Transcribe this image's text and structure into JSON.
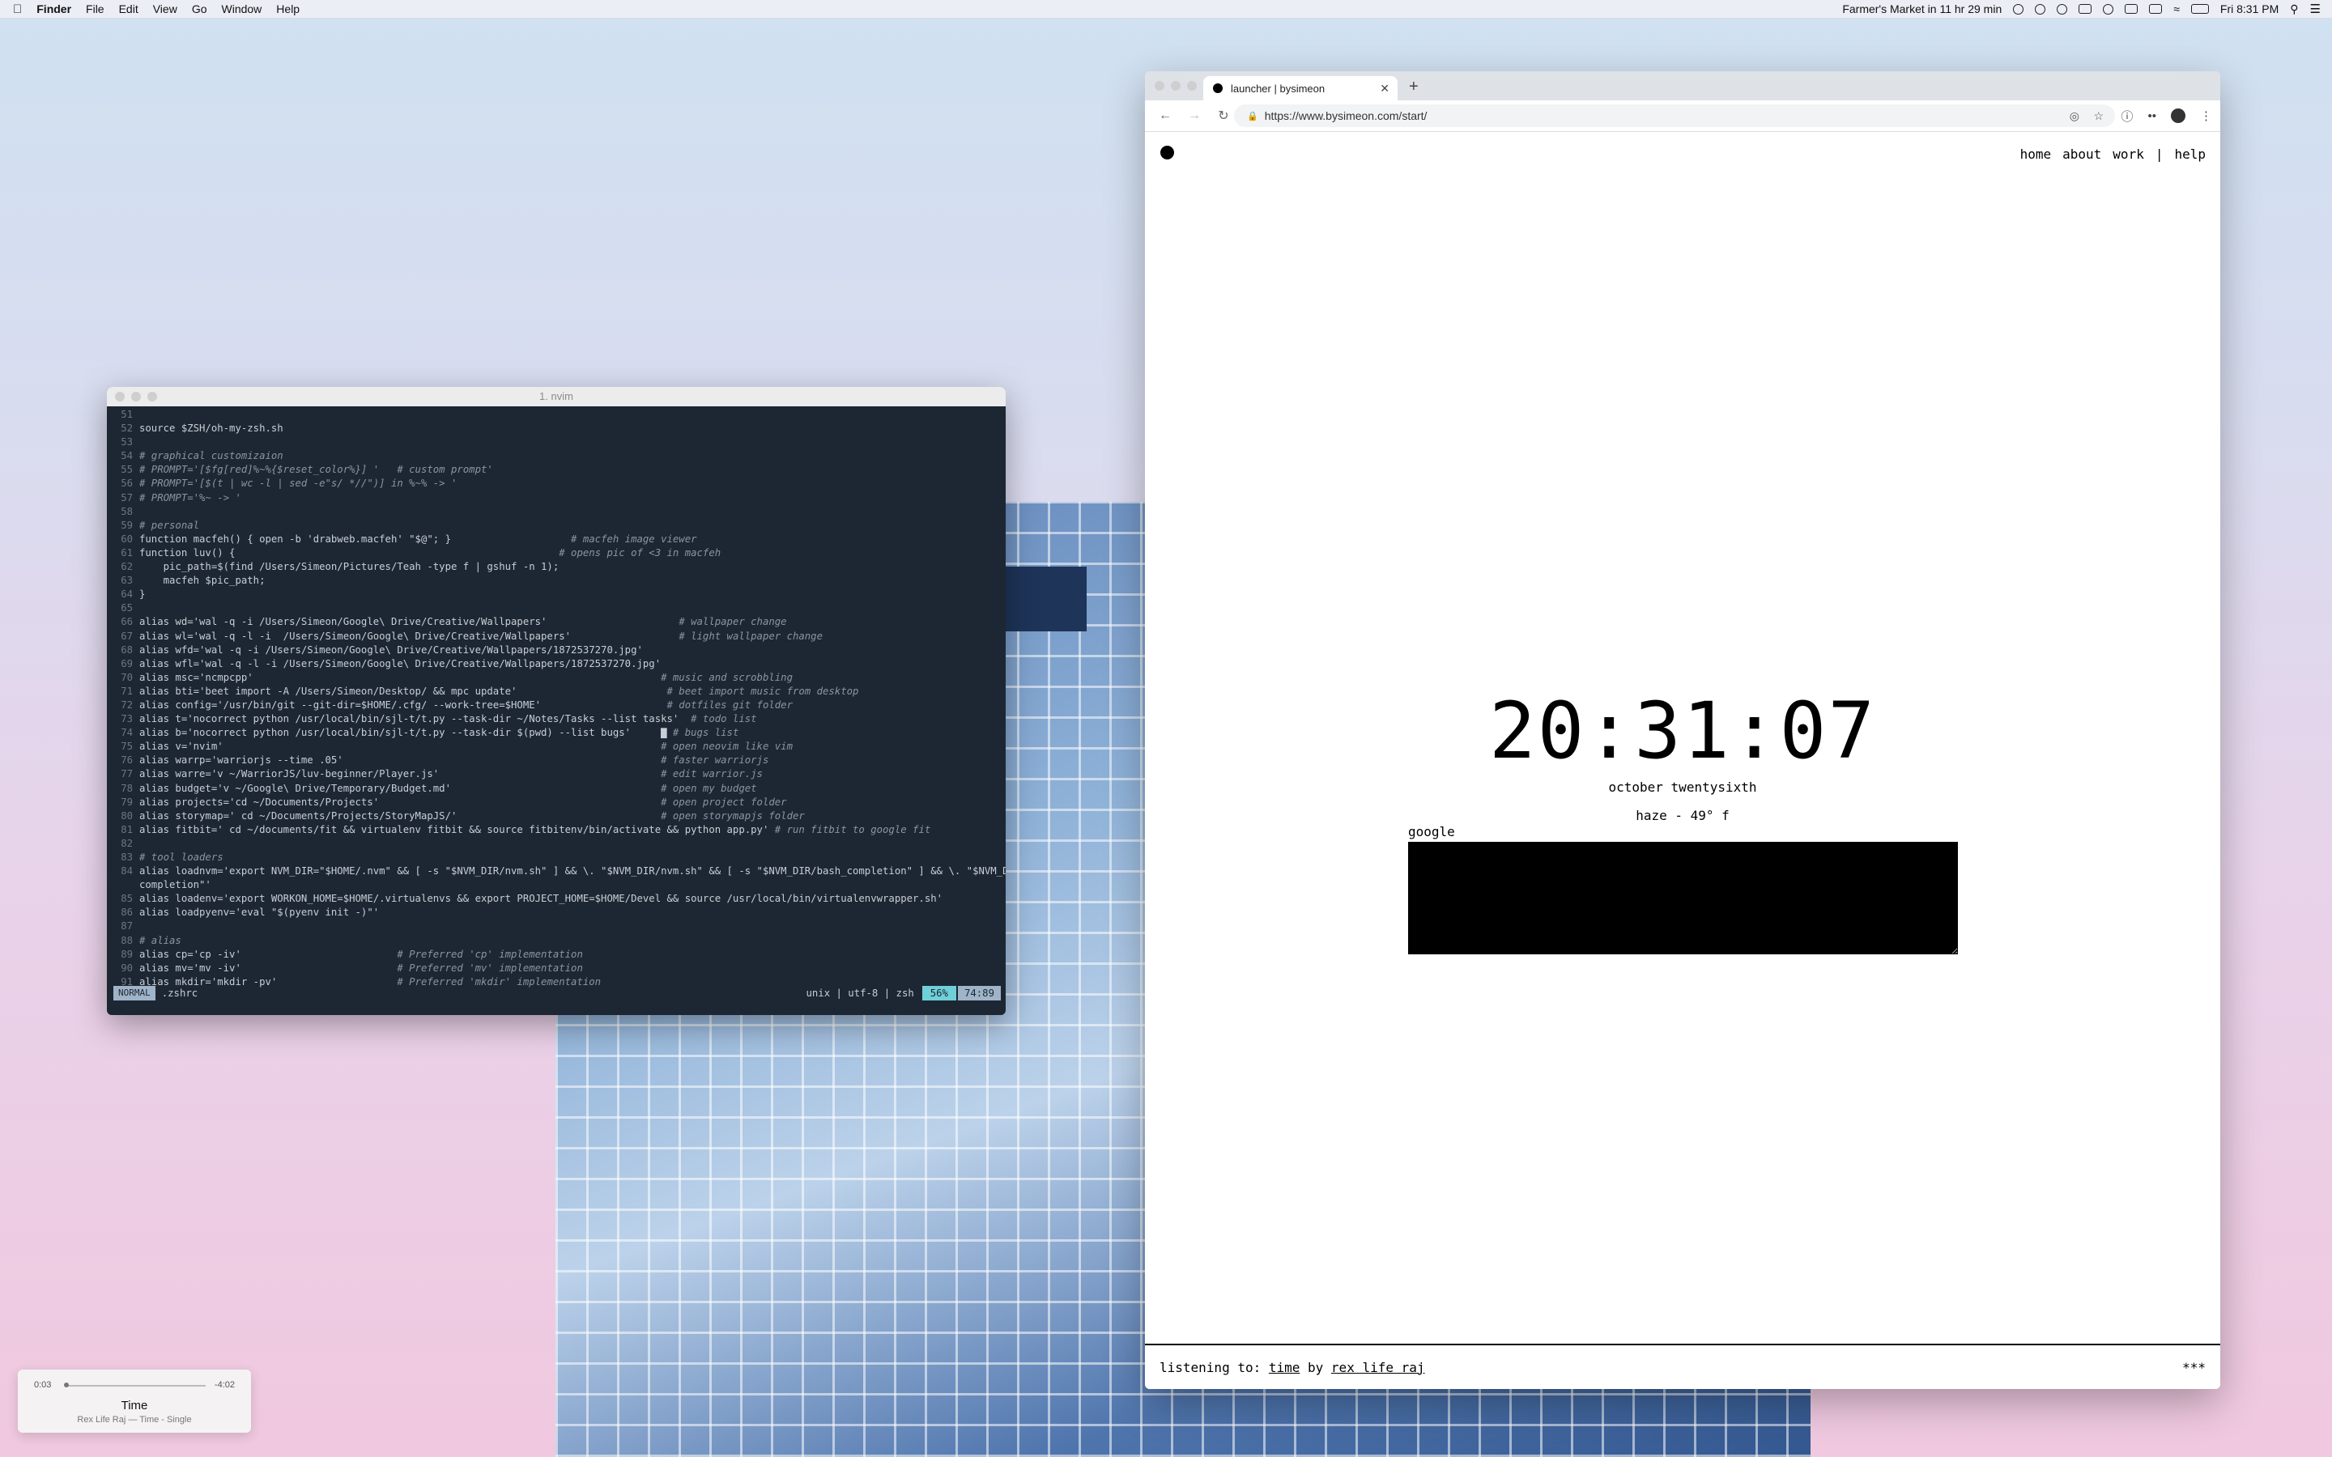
{
  "menubar": {
    "app_name": "Finder",
    "menus": [
      "File",
      "Edit",
      "View",
      "Go",
      "Window",
      "Help"
    ],
    "event_reminder": "Farmer's Market in 11 hr 29 min",
    "clock": "Fri 8:31 PM"
  },
  "terminal": {
    "title": "1. nvim",
    "lines": [
      {
        "n": "51",
        "code": "",
        "comment": ""
      },
      {
        "n": "52",
        "code": "source $ZSH/oh-my-zsh.sh",
        "comment": ""
      },
      {
        "n": "53",
        "code": "",
        "comment": ""
      },
      {
        "n": "54",
        "code": "",
        "comment": "# graphical customizaion"
      },
      {
        "n": "55",
        "code": "",
        "comment": "# PROMPT='[$fg[red]%~%{$reset_color%}] '   # custom prompt'"
      },
      {
        "n": "56",
        "code": "",
        "comment": "# PROMPT='[$(t | wc -l | sed -e\"s/ *//\")] in %~% -> '"
      },
      {
        "n": "57",
        "code": "",
        "comment": "# PROMPT='%~ -> '"
      },
      {
        "n": "58",
        "code": "",
        "comment": ""
      },
      {
        "n": "59",
        "code": "",
        "comment": "# personal"
      },
      {
        "n": "60",
        "code": "function macfeh() { open -b 'drabweb.macfeh' \"$@\"; }                    ",
        "comment": "# macfeh image viewer"
      },
      {
        "n": "61",
        "code": "function luv() {                                                      ",
        "comment": "# opens pic of <3 in macfeh"
      },
      {
        "n": "62",
        "code": "    pic_path=$(find /Users/Simeon/Pictures/Teah -type f | gshuf -n 1);",
        "comment": ""
      },
      {
        "n": "63",
        "code": "    macfeh $pic_path;",
        "comment": ""
      },
      {
        "n": "64",
        "code": "}",
        "comment": ""
      },
      {
        "n": "65",
        "code": "",
        "comment": ""
      },
      {
        "n": "66",
        "code": "alias wd='wal -q -i /Users/Simeon/Google\\ Drive/Creative/Wallpapers'                      ",
        "comment": "# wallpaper change"
      },
      {
        "n": "67",
        "code": "alias wl='wal -q -l -i  /Users/Simeon/Google\\ Drive/Creative/Wallpapers'                  ",
        "comment": "# light wallpaper change"
      },
      {
        "n": "68",
        "code": "alias wfd='wal -q -i /Users/Simeon/Google\\ Drive/Creative/Wallpapers/1872537270.jpg'",
        "comment": ""
      },
      {
        "n": "69",
        "code": "alias wfl='wal -q -l -i /Users/Simeon/Google\\ Drive/Creative/Wallpapers/1872537270.jpg'",
        "comment": ""
      },
      {
        "n": "70",
        "code": "alias msc='ncmpcpp'                                                                    ",
        "comment": "# music and scrobbling"
      },
      {
        "n": "71",
        "code": "alias bti='beet import -A /Users/Simeon/Desktop/ && mpc update'                         ",
        "comment": "# beet import music from desktop"
      },
      {
        "n": "72",
        "code": "alias config='/usr/bin/git --git-dir=$HOME/.cfg/ --work-tree=$HOME'                     ",
        "comment": "# dotfiles git folder"
      },
      {
        "n": "73",
        "code": "alias t='nocorrect python /usr/local/bin/sjl-t/t.py --task-dir ~/Notes/Tasks --list tasks'  ",
        "comment": "# todo list"
      },
      {
        "n": "74",
        "code": "alias b='nocorrect python /usr/local/bin/sjl-t/t.py --task-dir $(pwd) --list bugs'     ▇ ",
        "comment": "# bugs list"
      },
      {
        "n": "75",
        "code": "alias v='nvim'                                                                         ",
        "comment": "# open neovim like vim"
      },
      {
        "n": "76",
        "code": "alias warrp='warriorjs --time .05'                                                     ",
        "comment": "# faster warriorjs"
      },
      {
        "n": "77",
        "code": "alias warre='v ~/WarriorJS/luv-beginner/Player.js'                                     ",
        "comment": "# edit warrior.js"
      },
      {
        "n": "78",
        "code": "alias budget='v ~/Google\\ Drive/Temporary/Budget.md'                                   ",
        "comment": "# open my budget"
      },
      {
        "n": "79",
        "code": "alias projects='cd ~/Documents/Projects'                                               ",
        "comment": "# open project folder"
      },
      {
        "n": "80",
        "code": "alias storymap=' cd ~/Documents/Projects/StoryMapJS/'                                  ",
        "comment": "# open storymapjs folder"
      },
      {
        "n": "81",
        "code": "alias fitbit=' cd ~/documents/fit && virtualenv fitbit && source fitbitenv/bin/activate && python app.py' ",
        "comment": "# run fitbit to google fit"
      },
      {
        "n": "82",
        "code": "",
        "comment": ""
      },
      {
        "n": "83",
        "code": "",
        "comment": "# tool loaders"
      },
      {
        "n": "84",
        "code": "alias loadnvm='export NVM_DIR=\"$HOME/.nvm\" && [ -s \"$NVM_DIR/nvm.sh\" ] && \\. \"$NVM_DIR/nvm.sh\" && [ -s \"$NVM_DIR/bash_completion\" ] && \\. \"$NVM_DIR/bash_",
        "comment": ""
      },
      {
        "n": "",
        "code": "completion\"'",
        "comment": ""
      },
      {
        "n": "85",
        "code": "alias loadenv='export WORKON_HOME=$HOME/.virtualenvs && export PROJECT_HOME=$HOME/Devel && source /usr/local/bin/virtualenvwrapper.sh'",
        "comment": ""
      },
      {
        "n": "86",
        "code": "alias loadpyenv='eval \"$(pyenv init -)\"'",
        "comment": ""
      },
      {
        "n": "87",
        "code": "",
        "comment": ""
      },
      {
        "n": "88",
        "code": "",
        "comment": "# alias"
      },
      {
        "n": "89",
        "code": "alias cp='cp -iv'                          ",
        "comment": "# Preferred 'cp' implementation"
      },
      {
        "n": "90",
        "code": "alias mv='mv -iv'                          ",
        "comment": "# Preferred 'mv' implementation"
      },
      {
        "n": "91",
        "code": "alias mkdir='mkdir -pv'                    ",
        "comment": "# Preferred 'mkdir' implementation"
      }
    ],
    "status": {
      "mode": "NORMAL",
      "filename": ".zshrc",
      "info": "unix | utf-8 | zsh",
      "percent": "56%",
      "position": "74:89"
    }
  },
  "browser": {
    "tab_title": "launcher | bysimeon",
    "url": "https://www.bysimeon.com/start/",
    "nav": [
      "home",
      "about",
      "work",
      "|",
      "help"
    ],
    "clock": "20:31:07",
    "date": "october twentysixth",
    "weather": "haze - 49° f",
    "search_label": "google",
    "footer": {
      "prefix": "listening to: ",
      "song": "time",
      "by": " by ",
      "artist": "rex life raj",
      "menu": "***"
    }
  },
  "now_playing": {
    "elapsed": "0:03",
    "remaining": "-4:02",
    "progress": 0.012,
    "title": "Time",
    "subtitle": "Rex Life Raj — Time - Single"
  }
}
